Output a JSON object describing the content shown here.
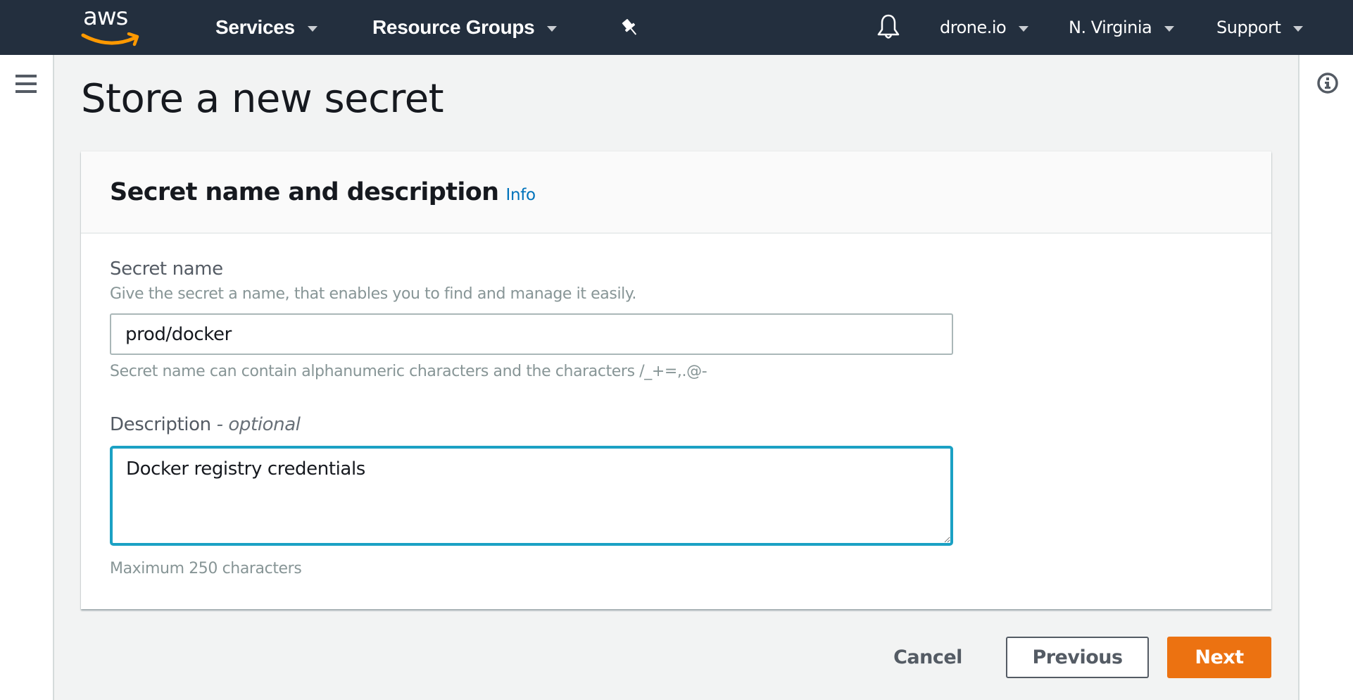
{
  "topnav": {
    "logo_text": "aws",
    "services_label": "Services",
    "resource_groups_label": "Resource Groups",
    "account_label": "drone.io",
    "region_label": "N. Virginia",
    "support_label": "Support",
    "icons": {
      "pin": "pushpin-icon",
      "bell": "bell-icon"
    }
  },
  "page": {
    "title": "Store a new secret"
  },
  "card": {
    "title": "Secret name and description",
    "info_link": "Info",
    "secret_name": {
      "label": "Secret name",
      "description": "Give the secret a name, that enables you to find and manage it easily.",
      "value": "prod/docker",
      "constraint": "Secret name can contain alphanumeric characters and the characters /_+=,.@-"
    },
    "description": {
      "label": "Description",
      "optional_suffix": "- optional",
      "value": "Docker registry credentials",
      "constraint": "Maximum 250 characters"
    }
  },
  "actions": {
    "cancel": "Cancel",
    "previous": "Previous",
    "next": "Next"
  },
  "colors": {
    "nav_background": "#232f3e",
    "primary_button": "#ec7211",
    "focus_border": "#1ba1c4",
    "link": "#0073bb",
    "logo_smile": "#ff9900"
  }
}
